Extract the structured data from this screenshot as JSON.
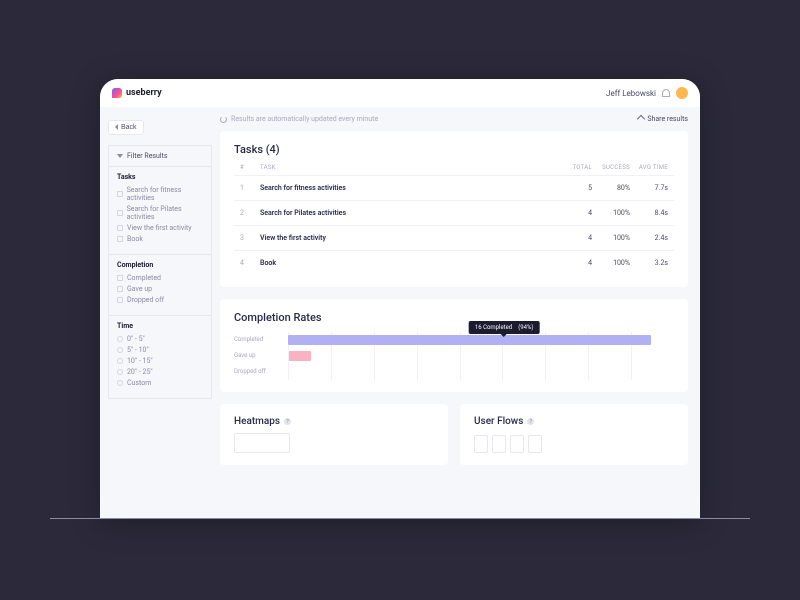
{
  "brand": "useberry",
  "user": {
    "name": "Jeff Lebowski"
  },
  "back_label": "Back",
  "meta": {
    "auto_update": "Results are automatically updated every minute",
    "share": "Share results"
  },
  "filters": {
    "title": "Filter Results",
    "groups": [
      {
        "title": "Tasks",
        "type": "check",
        "items": [
          "Search for fitness activities",
          "Search for Pilates activities",
          "View the first activity",
          "Book"
        ]
      },
      {
        "title": "Completion",
        "type": "check",
        "items": [
          "Completed",
          "Gave up",
          "Dropped off"
        ]
      },
      {
        "title": "Time",
        "type": "radio",
        "items": [
          "0\" - 5\"",
          "5\" - 10\"",
          "10\" - 15\"",
          "20\" - 25\"",
          "Custom"
        ]
      }
    ]
  },
  "tasks_card": {
    "title": "Tasks (4)",
    "cols": {
      "num": "#",
      "task": "TASK",
      "total": "TOTAL",
      "success": "SUCCESS",
      "avg": "AVG TIME"
    },
    "rows": [
      {
        "n": "1",
        "name": "Search for fitness activities",
        "total": "5",
        "success": "80%",
        "avg": "7.7s"
      },
      {
        "n": "2",
        "name": "Search for Pilates activities",
        "total": "4",
        "success": "100%",
        "avg": "8.4s"
      },
      {
        "n": "3",
        "name": "View the first activity",
        "total": "4",
        "success": "100%",
        "avg": "2.4s"
      },
      {
        "n": "4",
        "name": "Book",
        "total": "4",
        "success": "100%",
        "avg": "3.2s"
      }
    ]
  },
  "completion": {
    "title": "Completion Rates",
    "rows": [
      {
        "label": "Completed",
        "pct": 94
      },
      {
        "label": "Gave up",
        "pct": 6
      },
      {
        "label": "Dropped off",
        "pct": 0
      }
    ],
    "tooltip": {
      "count": "16 Completed",
      "pct": "(94%)"
    }
  },
  "heatmaps": {
    "title": "Heatmaps"
  },
  "userflows": {
    "title": "User Flows"
  },
  "chart_data": {
    "type": "bar",
    "orientation": "horizontal",
    "title": "Completion Rates",
    "categories": [
      "Completed",
      "Gave up",
      "Dropped off"
    ],
    "values": [
      94,
      6,
      0
    ],
    "xlabel": "",
    "ylabel": "",
    "xlim": [
      0,
      100
    ]
  }
}
